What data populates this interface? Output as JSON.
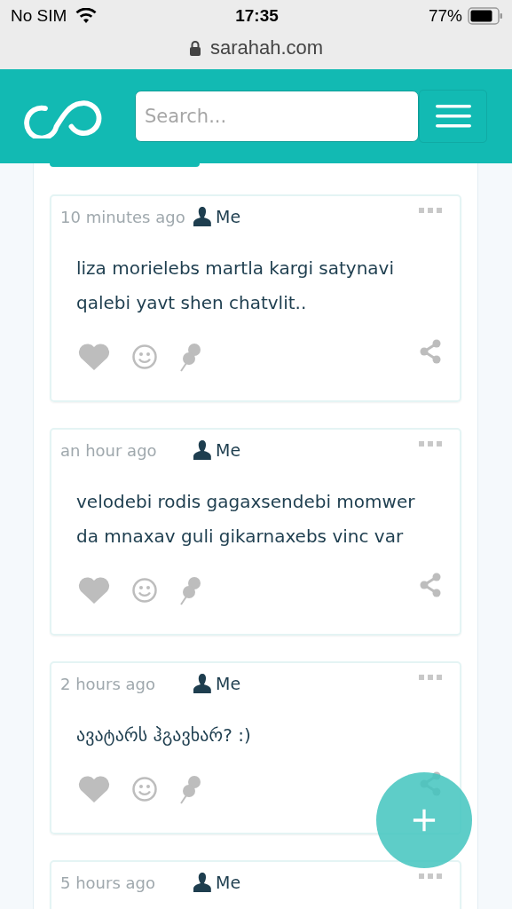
{
  "status_bar": {
    "carrier": "No SIM",
    "time": "17:35",
    "battery": "77%"
  },
  "address_bar": {
    "url": "sarahah.com"
  },
  "header": {
    "search": {
      "placeholder": "Search..."
    }
  },
  "messages": [
    {
      "time": "10 minutes ago",
      "author": "Me",
      "body": "liza morielebs martla kargi satynavi qalebi yavt shen chatvlit.."
    },
    {
      "time": "an hour ago",
      "author": "Me",
      "body": "velodebi rodis gagaxsendebi momwer da mnaxav guli gikarnaxebs vinc var"
    },
    {
      "time": "2 hours ago",
      "author": "Me",
      "body": "ავატარს ჰგავხარ? :)"
    },
    {
      "time": "5 hours ago",
      "author": "Me"
    }
  ]
}
